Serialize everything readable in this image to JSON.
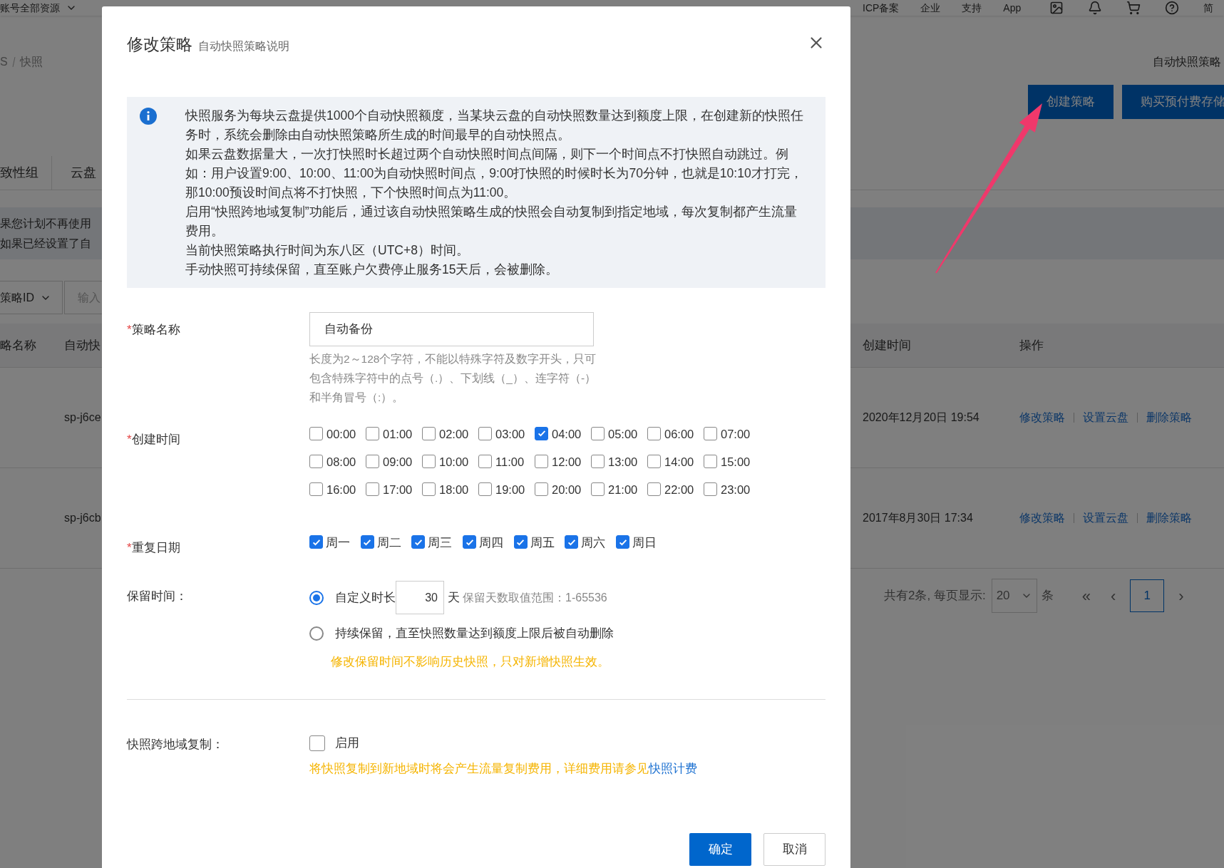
{
  "top_nav": {
    "menus": [
      {
        "label": "账号全部资源",
        "dropdown": true
      }
    ],
    "links": [
      "ICP备案",
      "企业",
      "支持",
      "App"
    ],
    "user": "简"
  },
  "background": {
    "breadcrumb": [
      "S",
      "快照"
    ],
    "page_title": "自动快照策略",
    "actions": [
      {
        "label": "创建策略",
        "kind": "primary"
      },
      {
        "label": "购买预付费存储",
        "kind": "primary"
      }
    ],
    "tabs": [
      "致性组",
      "云盘"
    ],
    "notice": [
      "果您计划不再使用",
      "如果已经设置了自"
    ],
    "filter": {
      "field": "策略ID",
      "placeholder": "输入"
    },
    "table": {
      "columns": [
        "略名称",
        "自动快",
        "创建时间",
        "操作"
      ],
      "rows": [
        {
          "column_2": "sp-j6ce",
          "created": "2020年12月20日 19:54",
          "actions": [
            "修改策略",
            "设置云盘",
            "删除策略"
          ]
        },
        {
          "column_2": "sp-j6cb",
          "created": "2017年8月30日 17:34",
          "actions": [
            "修改策略",
            "设置云盘",
            "删除策略"
          ]
        }
      ]
    },
    "pagination": {
      "summary": "共有2条, 每页显示:",
      "page_size": "20",
      "unit": "条",
      "first": "«",
      "prev": "‹",
      "pages": [
        {
          "label": "1",
          "selected": true
        }
      ],
      "next": "›"
    }
  },
  "dialog": {
    "title": "修改策略",
    "subtitle": "自动快照策略说明",
    "info": [
      "快照服务为每块云盘提供1000个自动快照额度，当某块云盘的自动快照数量达到额度上限，在创建新的快照任务时，系统会删除由自动快照策略所生成的时间最早的自动快照点。",
      "如果云盘数据量大，一次打快照时长超过两个自动快照时间点间隔，则下一个时间点不打快照自动跳过。例如：用户设置9:00、10:00、11:00为自动快照时间点，9:00打快照的时候时长为70分钟，也就是10:10才打完，那10:00预设时间点将不打快照，下个快照时间点为11:00。",
      "启用“快照跨地域复制”功能后，通过该自动快照策略生成的快照会自动复制到指定地域，每次复制都产生流量费用。",
      "当前快照策略执行时间为东八区（UTC+8）时间。",
      "手动快照可持续保留，直至账户欠费停止服务15天后，会被删除。"
    ],
    "name_field": {
      "mark": "*",
      "label": "策略名称",
      "value": "自动备份",
      "hint": [
        "长度为2～128个字符，不能以特殊字符及数字开头，只可",
        "包含特殊字符中的点号（.）、下划线（_）、连字符（-）",
        "和半角冒号（:）。"
      ]
    },
    "times": {
      "mark": "*",
      "label": "创建时间",
      "options": [
        {
          "label": "00:00",
          "checked": false
        },
        {
          "label": "01:00",
          "checked": false
        },
        {
          "label": "02:00",
          "checked": false
        },
        {
          "label": "03:00",
          "checked": false
        },
        {
          "label": "04:00",
          "checked": true
        },
        {
          "label": "05:00",
          "checked": false
        },
        {
          "label": "06:00",
          "checked": false
        },
        {
          "label": "07:00",
          "checked": false
        },
        {
          "label": "08:00",
          "checked": false
        },
        {
          "label": "09:00",
          "checked": false
        },
        {
          "label": "10:00",
          "checked": false
        },
        {
          "label": "11:00",
          "checked": false
        },
        {
          "label": "12:00",
          "checked": false
        },
        {
          "label": "13:00",
          "checked": false
        },
        {
          "label": "14:00",
          "checked": false
        },
        {
          "label": "15:00",
          "checked": false
        },
        {
          "label": "16:00",
          "checked": false
        },
        {
          "label": "17:00",
          "checked": false
        },
        {
          "label": "18:00",
          "checked": false
        },
        {
          "label": "19:00",
          "checked": false
        },
        {
          "label": "20:00",
          "checked": false
        },
        {
          "label": "21:00",
          "checked": false
        },
        {
          "label": "22:00",
          "checked": false
        },
        {
          "label": "23:00",
          "checked": false
        }
      ]
    },
    "days": {
      "mark": "*",
      "label": "重复日期",
      "options": [
        {
          "label": "周一",
          "checked": true
        },
        {
          "label": "周二",
          "checked": true
        },
        {
          "label": "周三",
          "checked": true
        },
        {
          "label": "周四",
          "checked": true
        },
        {
          "label": "周五",
          "checked": true
        },
        {
          "label": "周六",
          "checked": true
        },
        {
          "label": "周日",
          "checked": true
        }
      ]
    },
    "retention": {
      "label": "保留时间：",
      "options": [
        {
          "kind": "custom",
          "label": "自定义时长",
          "selected": true,
          "value": "30",
          "unit": "天",
          "range": "保留天数取值范围：1-65536"
        },
        {
          "kind": "forever",
          "label": "持续保留，直至快照数量达到额度上限后被自动删除",
          "selected": false
        }
      ],
      "note": "修改保留时间不影响历史快照，只对新增快照生效。"
    },
    "replication": {
      "label": "快照跨地域复制：",
      "checkbox": {
        "label": "启用",
        "checked": false
      },
      "note": "将快照复制到新地域时将会产生流量复制费用，详细费用请参见",
      "link": "快照计费"
    },
    "buttons": [
      {
        "label": "确定",
        "kind": "primary"
      },
      {
        "label": "取消",
        "kind": "secondary"
      }
    ]
  }
}
